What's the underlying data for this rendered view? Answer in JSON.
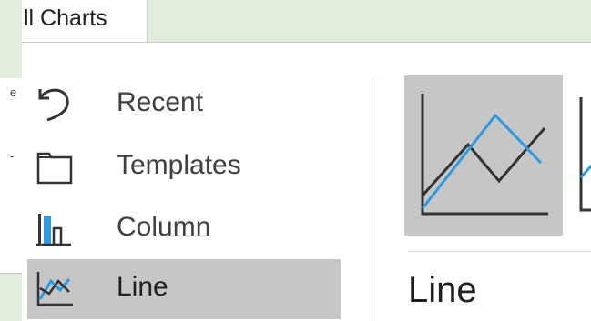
{
  "dialog": {
    "tab_label": "ll Charts",
    "left_fragments": [
      "e",
      "-"
    ],
    "categories": [
      {
        "label": "Recent",
        "icon": "recent-icon",
        "selected": false
      },
      {
        "label": "Templates",
        "icon": "templates-icon",
        "selected": false
      },
      {
        "label": "Column",
        "icon": "column-chart-icon",
        "selected": false
      },
      {
        "label": "Line",
        "icon": "line-chart-icon",
        "selected": true
      }
    ],
    "selected_title": "Line",
    "colors": {
      "accent": "#2e9be0",
      "selected_bg": "#c6c6c6",
      "frame_bg": "#e1eedb"
    }
  }
}
